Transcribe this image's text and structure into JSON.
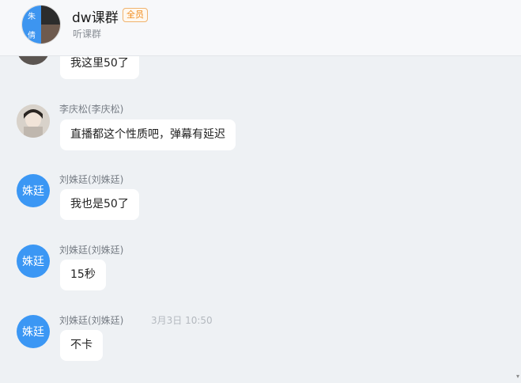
{
  "header": {
    "title": "dw课群",
    "badge": "全员",
    "subtitle": "听课群",
    "avatar_chars": [
      "朱",
      "倩"
    ]
  },
  "messages": [
    {
      "sender": "",
      "text": "我这里50了",
      "avatar_label": ""
    },
    {
      "sender": "李庆松(李庆松)",
      "text": "直播都这个性质吧，弹幕有延迟",
      "avatar_label": ""
    },
    {
      "sender": "刘姝廷(刘姝廷)",
      "text": "我也是50了",
      "avatar_label": "姝廷"
    },
    {
      "sender": "刘姝廷(刘姝廷)",
      "text": "15秒",
      "avatar_label": "姝廷"
    },
    {
      "sender": "刘姝廷(刘姝廷)",
      "time": "3月3日 10:50",
      "text": "不卡",
      "avatar_label": "姝廷"
    }
  ],
  "colors": {
    "accent": "#3b97f4",
    "background": "#eef1f4",
    "badge": "#f08c1e"
  },
  "icons": {
    "scroll_down": "▾"
  }
}
